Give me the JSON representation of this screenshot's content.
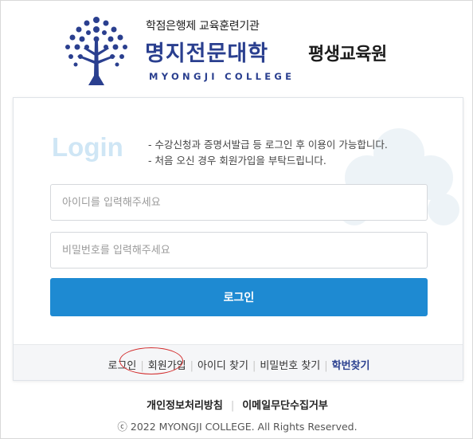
{
  "header": {
    "institution_small": "학점은행제 교육훈련기관",
    "college_name": "명지전문대학",
    "college_sub": "평생교육원",
    "college_english": "MYONGJI COLLEGE",
    "brand_color": "#2a3f8f"
  },
  "login": {
    "title": "Login",
    "notice_line1": "- 수강신청과 증명서발급 등 로그인 후 이용이 가능합니다.",
    "notice_line2": "- 처음 오신 경우 회원가입을 부탁드립니다.",
    "id_placeholder": "아이디를 입력해주세요",
    "pw_placeholder": "비밀번호를 입력해주세요",
    "button_label": "로그인",
    "button_color": "#1e8ad2"
  },
  "links": {
    "login": "로그인",
    "signup": "회원가입",
    "find_id": "아이디 찾기",
    "find_pw": "비밀번호 찾기",
    "find_student_no": "학번찾기",
    "highlight_color": "#d22a2a"
  },
  "footer": {
    "privacy": "개인정보처리방침",
    "email_refusal": "이메일무단수집거부",
    "copyright": "ⓒ 2022 MYONGJI COLLEGE. All Rights Reserved."
  },
  "icons": {
    "logo": "tree-logo-icon",
    "watermark": "tree-watermark-icon"
  }
}
